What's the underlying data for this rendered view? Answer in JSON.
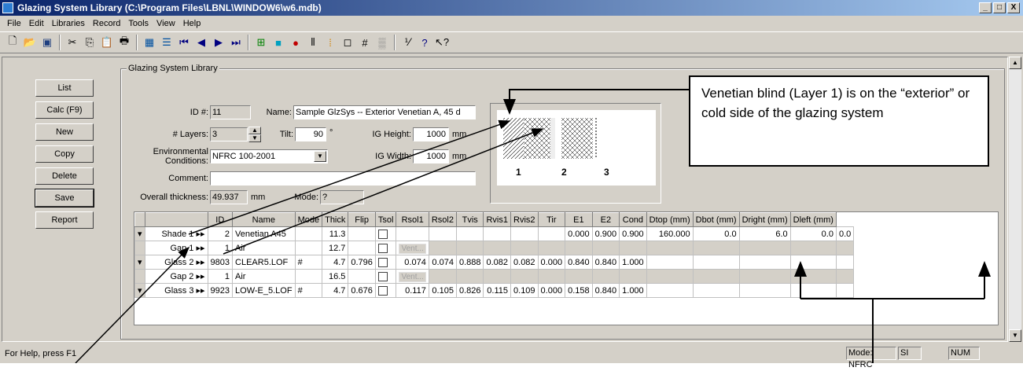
{
  "window": {
    "title": "Glazing System Library (C:\\Program Files\\LBNL\\WINDOW6\\w6.mdb)",
    "min": "_",
    "max": "□",
    "close": "X"
  },
  "menu": [
    "File",
    "Edit",
    "Libraries",
    "Record",
    "Tools",
    "View",
    "Help"
  ],
  "buttons": {
    "list": "List",
    "calc": "Calc (F9)",
    "new": "New",
    "copy": "Copy",
    "delete": "Delete",
    "save": "Save",
    "report": "Report"
  },
  "group_label": "Glazing System Library",
  "form": {
    "id_label": "ID #:",
    "id_value": "11",
    "name_label": "Name:",
    "name_value": "Sample GlzSys -- Exterior Venetian A, 45 d",
    "layers_label": "# Layers:",
    "layers_value": "3",
    "tilt_label": "Tilt:",
    "tilt_value": "90",
    "tilt_unit": "°",
    "igh_label": "IG Height:",
    "igh_value": "1000",
    "igh_unit": "mm",
    "env_label": "Environmental Conditions:",
    "env_value": "NFRC 100-2001",
    "igw_label": "IG Width:",
    "igw_value": "1000",
    "igw_unit": "mm",
    "comment_label": "Comment:",
    "comment_value": "",
    "thick_label": "Overall thickness:",
    "thick_value": "49.937",
    "thick_unit": "mm",
    "mode_label": "Mode:",
    "mode_value": "?"
  },
  "preview": {
    "labels": [
      "1",
      "2",
      "3"
    ]
  },
  "table": {
    "headers": [
      "",
      "",
      "ID",
      "Name",
      "Mode",
      "Thick",
      "Flip",
      "Tsol",
      "Rsol1",
      "Rsol2",
      "Tvis",
      "Rvis1",
      "Rvis2",
      "Tir",
      "E1",
      "E2",
      "Cond",
      "Dtop (mm)",
      "Dbot (mm)",
      "Dright (mm)",
      "Dleft (mm)"
    ],
    "rows": [
      [
        "Shade 1",
        "2",
        "Venetian A45",
        "",
        "11.3",
        "",
        "",
        "",
        "",
        "",
        "",
        "",
        "0.000",
        "0.900",
        "0.900",
        "160.000",
        "0.0",
        "6.0",
        "0.0",
        "0.0"
      ],
      [
        "Gap 1",
        "1",
        "Air",
        "",
        "12.7",
        "",
        "Vent...",
        "",
        "",
        "",
        "",
        "",
        "",
        "",
        "",
        "",
        "",
        "",
        "",
        ""
      ],
      [
        "Glass 2",
        "9803",
        "CLEAR5.LOF",
        "#",
        "4.7",
        "0.796",
        "0.074",
        "0.074",
        "0.888",
        "0.082",
        "0.082",
        "0.000",
        "0.840",
        "0.840",
        "1.000",
        "",
        "",
        "",
        "",
        ""
      ],
      [
        "Gap 2",
        "1",
        "Air",
        "",
        "16.5",
        "",
        "Vent...",
        "",
        "",
        "",
        "",
        "",
        "",
        "",
        "",
        "",
        "",
        "",
        "",
        ""
      ],
      [
        "Glass 3",
        "9923",
        "LOW-E_5.LOF",
        "#",
        "4.7",
        "0.676",
        "0.117",
        "0.105",
        "0.826",
        "0.115",
        "0.109",
        "0.000",
        "0.158",
        "0.840",
        "1.000",
        "",
        "",
        "",
        "",
        ""
      ]
    ]
  },
  "status": {
    "help": "For Help, press F1",
    "mode": "Mode: NFRC",
    "units": "SI",
    "num": "NUM"
  },
  "callout": "Venetian blind (Layer 1) is on the “exterior” or cold side of the glazing system",
  "icons": [
    "new-icon",
    "open-icon",
    "save-icon",
    "cut-icon",
    "copy-icon",
    "paste-icon",
    "print-icon",
    "grid-icon",
    "list-icon",
    "first-icon",
    "prev-icon",
    "next-icon",
    "last-icon",
    "grid2-icon",
    "color-icon",
    "pin-icon",
    "bars-icon",
    "thermal-icon",
    "frame-icon",
    "hash-icon",
    "pattern-icon",
    "calc-icon",
    "help-icon",
    "whatsthis-icon"
  ]
}
